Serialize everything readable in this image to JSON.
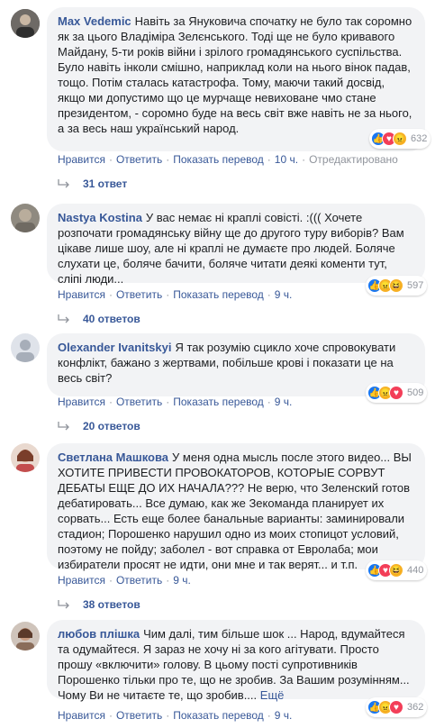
{
  "comments": [
    {
      "author": "Max Vedemic",
      "text": "Навіть за Януковича спочатку не було так соромно як за цього Владіміра Зелєнського. Тоді ще не було кривавого Майдану, 5-ти років війни і зрілого громадянського суспільства. Було навіть інколи смішно, наприклад коли на нього вінок падав, тощо. Потім сталась катастрофа. Тому, маючи такий досвід, якщо ми допустимо що це мурчаще невиховане чмо стане президентом, - соромно буде на весь світ вже навіть не за нього, а за весь наш український народ.",
      "more": "",
      "reactions": "632",
      "like": "Нравится",
      "reply": "Ответить",
      "translate": "Показать перевод",
      "time": "10 ч.",
      "edited": "Отредактировано",
      "replies": "31 ответ"
    },
    {
      "author": "Nastya Kostina",
      "text": "У вас немає ні краплі совісті. :((( Хочете розпочати громадянську війну ще до другого туру виборів? Вам цікаве лише шоу, але ні краплі не думаєте про людей. Боляче слухати це, боляче бачити, боляче читати деякі коменти тут, сліпі люди...",
      "more": "",
      "reactions": "597",
      "like": "Нравится",
      "reply": "Ответить",
      "translate": "Показать перевод",
      "time": "9 ч.",
      "replies": "40 ответов"
    },
    {
      "author": "Olexander Ivanitskyi",
      "text": "Я так розумію сцикло хоче спровокувати конфлікт, бажано з жертвами, побільше крові і показати це на весь світ?",
      "more": "",
      "reactions": "509",
      "like": "Нравится",
      "reply": "Ответить",
      "translate": "Показать перевод",
      "time": "9 ч.",
      "replies": "20 ответов"
    },
    {
      "author": "Светлана Машкова",
      "text": "У меня одна мысль после этого видео... ВЫ ХОТИТЕ ПРИВЕСТИ ПРОВОКАТОРОВ, КОТОРЫЕ СОРВУТ ДЕБАТЫ ЕЩЕ ДО ИХ НАЧАЛА??? Не верю, что Зеленский готов дебатировать... Все думаю, как же Зекоманда планирует их сорвать... Есть еще более банальные варианты: заминировали стадион; Порошенко нарушил одно из моих стопицот условий, поэтому не пойду; заболел - вот справка от Евролаба; мои избиратели просят не идти, они мне и так верят... и т.п.",
      "more": "",
      "reactions": "440",
      "like": "Нравится",
      "reply": "Ответить",
      "time": "9 ч.",
      "replies": "38 ответов"
    },
    {
      "author": "любов плішка",
      "text": "Чим далі, тим більше шок ... Народ, вдумайтеся та одумайтеся. Я зараз не хочу ні за кого агітувати. Просто прошу «включити» голову. В цьому пості супротивників Порошенко тільки про те, що не зробив. За Вашим розумінням... Чому Ви не читаєте те, що зробив....",
      "more": "Ещё",
      "reactions": "362",
      "like": "Нравится",
      "reply": "Ответить",
      "translate": "Показать перевод",
      "time": "9 ч."
    }
  ],
  "icons": {
    "like": "thumbs-up",
    "love": "heart",
    "angry": "angry-face",
    "haha": "laughing-face",
    "reply": "reply-arrow"
  },
  "colors": {
    "link": "#385898",
    "meta": "#90949c",
    "bubble": "#f2f3f5",
    "like": "#1877f2",
    "love": "#f33e58"
  }
}
